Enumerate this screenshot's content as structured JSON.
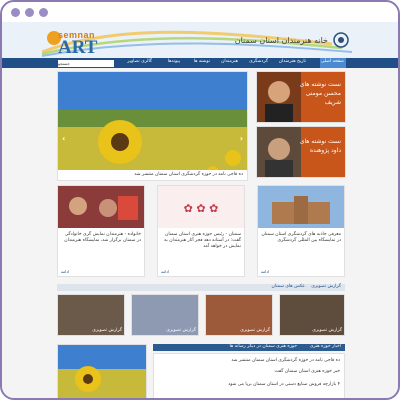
{
  "header": {
    "logo_top": "semnan",
    "logo_main": "ART",
    "site_title": "خانه هنرمندان استان سمنان"
  },
  "nav": {
    "items": [
      "صفحه اصلی",
      "تاریخ هنرمندان",
      "گردشگری",
      "هنرمندان",
      "نوشته ها",
      "پیوندها",
      "گالری تصاویر"
    ],
    "search_button": "جستجو",
    "search_placeholder": ""
  },
  "slider": {
    "caption": "ده قاجی نامه در حوزه گردشگری استان سمنان منتشر شد"
  },
  "features": {
    "top": "نست نوشته های محسن مومنی شریف",
    "bottom": "نست نوشته های داود پژوهنده"
  },
  "news": [
    {
      "text": "خانواده - هنرمندان نمایش گری خانوادگی در سمنان برگزار شد، نمایشگاه هنرمندان"
    },
    {
      "text": "سمنان - رئیس حوزه هنری استان سمنان گفت: در آستانه دهه فجر آثار هنرمندان به نمایش در خواهد آمد"
    },
    {
      "text": "معرفی جاذبه های گردشگری استان سمنان در نمایشگاه بین المللی گردشگری"
    }
  ],
  "more_label": "ادامه",
  "section_left": "عکس های سمنان",
  "section_right": "گزارش تصویری",
  "photo_captions": [
    "گزارش تصویری",
    "گزارش تصویری",
    "گزارش تصویری",
    "گزارش تصویری"
  ],
  "bottom_bar_left": "حوزه هنری سمنان در دیگر رسانه ها",
  "bottom_bar_right": "اخبار حوزه هنری",
  "bottom_items": [
    "ده قاجی نامه در حوزه گردشگری استان سمنان منتشر شد",
    "خبر حوزه هنری استان سمنان گفت",
    "۴ بازارچه فروش صنایع دستی در استان سمنان برپا می شود"
  ]
}
